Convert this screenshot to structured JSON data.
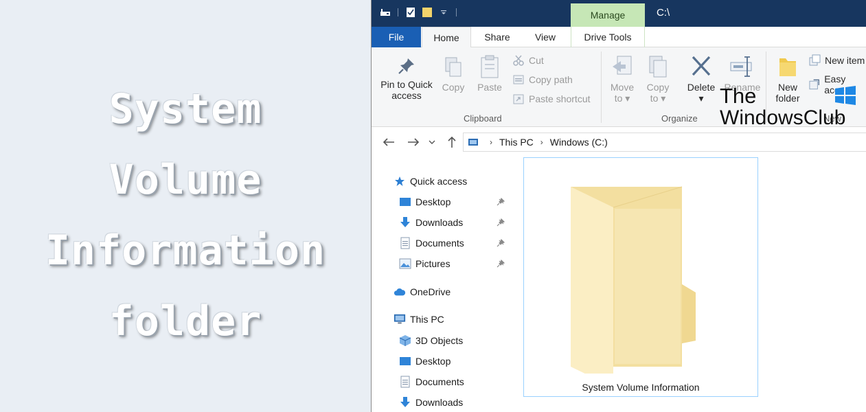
{
  "banner": {
    "lines": [
      "System",
      "Volume",
      "Information",
      "folder"
    ]
  },
  "titlebar": {
    "manage_tab": "Manage",
    "path": "C:\\"
  },
  "tabs": {
    "file": "File",
    "home": "Home",
    "share": "Share",
    "view": "View",
    "drive_tools": "Drive Tools"
  },
  "ribbon": {
    "clipboard": {
      "pin_line1": "Pin to Quick",
      "pin_line2": "access",
      "copy": "Copy",
      "paste": "Paste",
      "cut": "Cut",
      "copy_path": "Copy path",
      "paste_shortcut": "Paste shortcut",
      "label": "Clipboard"
    },
    "organize": {
      "move_line1": "Move",
      "move_line2": "to",
      "copy_line1": "Copy",
      "copy_line2": "to",
      "delete": "Delete",
      "rename": "Rename",
      "label": "Organize"
    },
    "new": {
      "folder_line1": "New",
      "folder_line2": "folder",
      "new_item": "New item",
      "easy_access": "Easy acce",
      "label": "New"
    }
  },
  "watermark": {
    "line1": "The",
    "line2": "WindowsClub"
  },
  "address": {
    "crumbs": [
      "This PC",
      "Windows (C:)"
    ]
  },
  "nav": {
    "quick_access": "Quick access",
    "qa_desktop": "Desktop",
    "qa_downloads": "Downloads",
    "qa_documents": "Documents",
    "qa_pictures": "Pictures",
    "onedrive": "OneDrive",
    "this_pc": "This PC",
    "pc_3d": "3D Objects",
    "pc_desktop": "Desktop",
    "pc_documents": "Documents",
    "pc_downloads": "Downloads"
  },
  "content": {
    "folder_name": "System Volume Information"
  },
  "colors": {
    "titlebar": "#17365f",
    "file_tab": "#1a5fb4",
    "manage_tab": "#c6e7b6",
    "folder": "#f8e4a8",
    "selection_border": "#99d1ff"
  }
}
